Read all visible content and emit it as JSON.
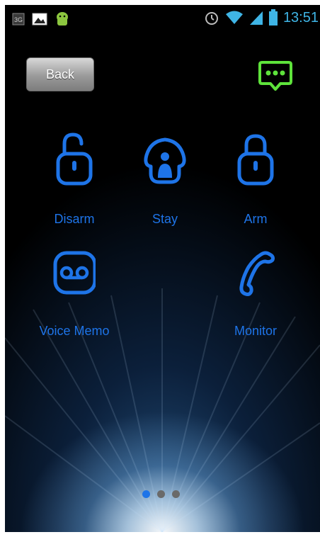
{
  "status_bar": {
    "time": "13:51",
    "left_icons": [
      "3g-icon",
      "image-icon",
      "android-icon"
    ],
    "right_icons": [
      "alarm-icon",
      "wifi-icon",
      "signal-icon",
      "battery-icon"
    ]
  },
  "header": {
    "back_label": "Back",
    "message_icon": "chat-bubble-icon"
  },
  "tiles": [
    {
      "label": "Disarm",
      "icon": "unlocked-padlock-icon"
    },
    {
      "label": "Stay",
      "icon": "home-user-icon"
    },
    {
      "label": "Arm",
      "icon": "locked-padlock-icon"
    },
    {
      "label": "Voice Memo",
      "icon": "voicemail-icon"
    },
    {
      "label": "Monitor",
      "icon": "phone-handset-icon"
    }
  ],
  "pager": {
    "pages": 3,
    "active": 1
  },
  "colors": {
    "accent": "#1e74e8",
    "message_icon": "#5ee33b",
    "status_text": "#3fb5e6"
  }
}
